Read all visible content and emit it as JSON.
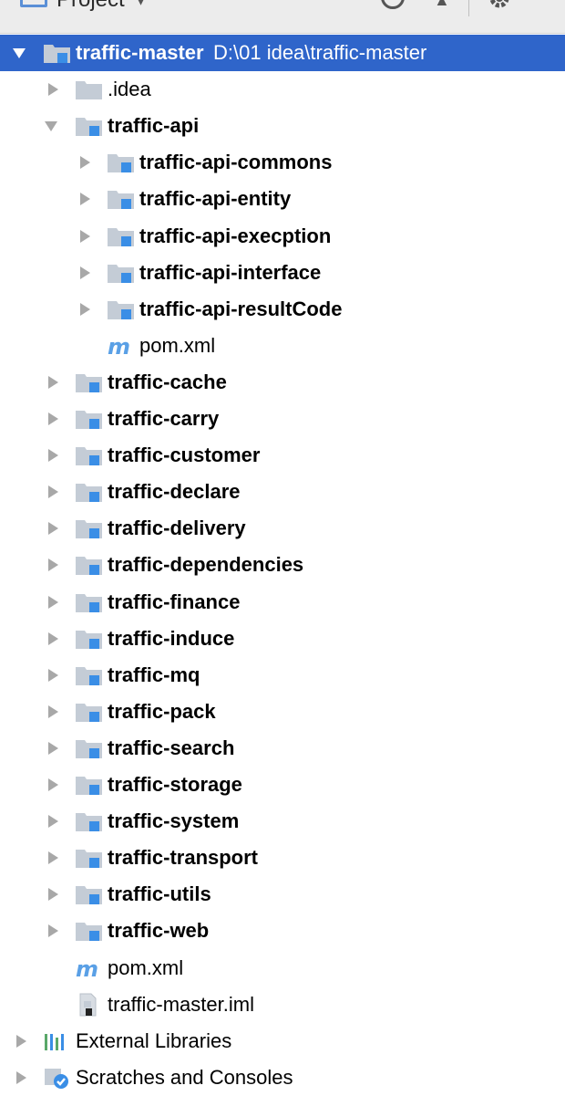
{
  "toolbar": {
    "view_label": "Project",
    "view_caret": "▾",
    "icons": [
      "project-view-icon",
      "locate-icon",
      "collapse-all-icon",
      "gear-icon"
    ]
  },
  "tree": {
    "root": {
      "name": "traffic-master",
      "path": "D:\\01 idea\\traffic-master"
    },
    "idea": ".idea",
    "traffic_api": "traffic-api",
    "api_children": [
      "traffic-api-commons",
      "traffic-api-entity",
      "traffic-api-execption",
      "traffic-api-interface",
      "traffic-api-resultCode"
    ],
    "api_pom": "pom.xml",
    "modules": [
      "traffic-cache",
      "traffic-carry",
      "traffic-customer",
      "traffic-declare",
      "traffic-delivery",
      "traffic-dependencies",
      "traffic-finance",
      "traffic-induce",
      "traffic-mq",
      "traffic-pack",
      "traffic-search",
      "traffic-storage",
      "traffic-system",
      "traffic-transport",
      "traffic-utils",
      "traffic-web"
    ],
    "root_pom": "pom.xml",
    "iml": "traffic-master.iml",
    "external_libraries": "External Libraries",
    "scratches": "Scratches and Consoles"
  },
  "colors": {
    "selection": "#2f65ca",
    "folder": "#c4ccd6",
    "module_badge": "#3a8ee6",
    "maven": "#5aa0e6",
    "arrow": "#a8a8a8"
  }
}
